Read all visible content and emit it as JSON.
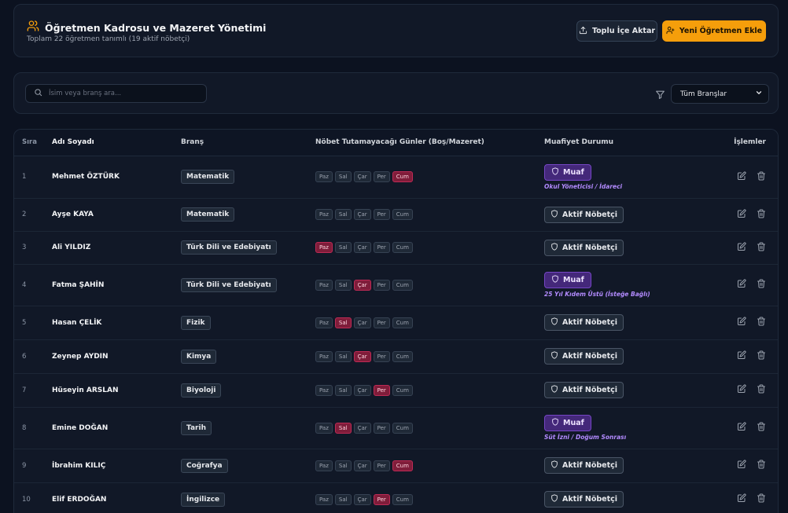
{
  "header": {
    "title": "Öğretmen Kadrosu ve Mazeret Yönetimi",
    "subtitle": "Toplam 22 öğretmen tanımlı (19 aktif nöbetçi)",
    "import_label": "Toplu İçe Aktar",
    "add_label": "Yeni Öğretmen Ekle",
    "accent": "#f59e0b"
  },
  "filters": {
    "search_placeholder": "İsim veya branş ara...",
    "branch_select": "Tüm Branşlar"
  },
  "table": {
    "headers": {
      "no": "Sıra",
      "name": "Adı Soyadı",
      "branch": "Branş",
      "days": "Nöbet Tutamayacağı Günler (Boş/Mazeret)",
      "status": "Muafiyet Durumu",
      "actions": "İşlemler"
    },
    "day_labels": [
      "Paz",
      "Sal",
      "Çar",
      "Per",
      "Cum"
    ],
    "rows": [
      {
        "no": "1",
        "name": "Mehmet ÖZTÜRK",
        "branch": "Matematik",
        "blocked": [
          false,
          false,
          false,
          false,
          true
        ],
        "status": "Muaf",
        "note": "Okul Yöneticisi / İdareci"
      },
      {
        "no": "2",
        "name": "Ayşe KAYA",
        "branch": "Matematik",
        "blocked": [
          false,
          false,
          false,
          false,
          false
        ],
        "status": "Aktif Nöbetçi",
        "note": ""
      },
      {
        "no": "3",
        "name": "Ali YILDIZ",
        "branch": "Türk Dili ve Edebiyatı",
        "blocked": [
          true,
          false,
          false,
          false,
          false
        ],
        "status": "Aktif Nöbetçi",
        "note": ""
      },
      {
        "no": "4",
        "name": "Fatma ŞAHİN",
        "branch": "Türk Dili ve Edebiyatı",
        "blocked": [
          false,
          false,
          true,
          false,
          false
        ],
        "status": "Muaf",
        "note": "25 Yıl Kıdem Üstü (İsteğe Bağlı)"
      },
      {
        "no": "5",
        "name": "Hasan ÇELİK",
        "branch": "Fizik",
        "blocked": [
          false,
          true,
          false,
          false,
          false
        ],
        "status": "Aktif Nöbetçi",
        "note": ""
      },
      {
        "no": "6",
        "name": "Zeynep AYDIN",
        "branch": "Kimya",
        "blocked": [
          false,
          false,
          true,
          false,
          false
        ],
        "status": "Aktif Nöbetçi",
        "note": ""
      },
      {
        "no": "7",
        "name": "Hüseyin ARSLAN",
        "branch": "Biyoloji",
        "blocked": [
          false,
          false,
          false,
          true,
          false
        ],
        "status": "Aktif Nöbetçi",
        "note": ""
      },
      {
        "no": "8",
        "name": "Emine DOĞAN",
        "branch": "Tarih",
        "blocked": [
          false,
          true,
          false,
          false,
          false
        ],
        "status": "Muaf",
        "note": "Süt İzni / Doğum Sonrası"
      },
      {
        "no": "9",
        "name": "İbrahim KILIÇ",
        "branch": "Coğrafya",
        "blocked": [
          false,
          false,
          false,
          false,
          true
        ],
        "status": "Aktif Nöbetçi",
        "note": ""
      },
      {
        "no": "10",
        "name": "Elif ERDOĞAN",
        "branch": "İngilizce",
        "blocked": [
          false,
          false,
          false,
          true,
          false
        ],
        "status": "Aktif Nöbetçi",
        "note": ""
      }
    ]
  }
}
